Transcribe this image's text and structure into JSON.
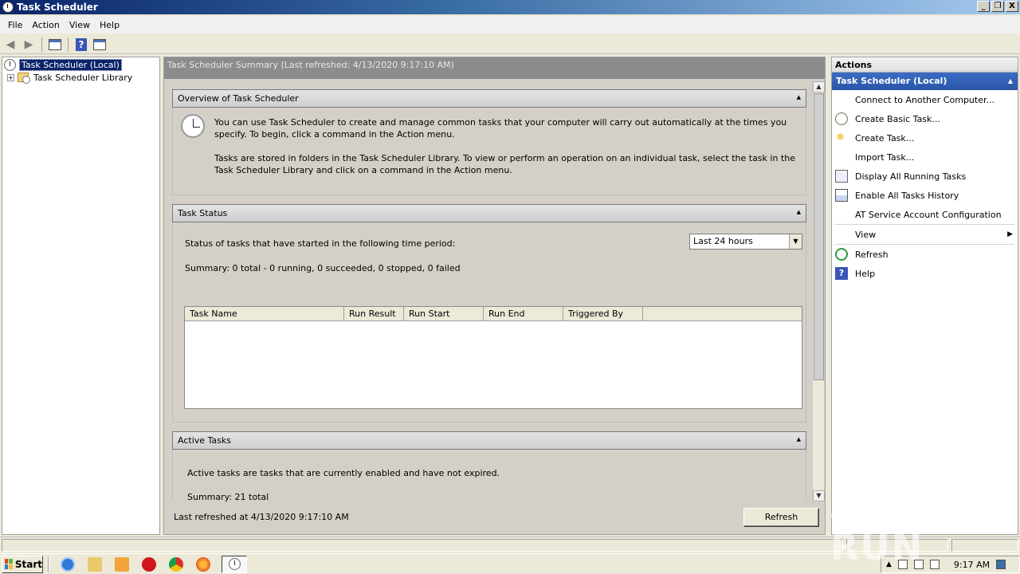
{
  "window": {
    "title": "Task Scheduler",
    "min": "_",
    "max": "❐",
    "close": "X"
  },
  "menu": [
    "File",
    "Action",
    "View",
    "Help"
  ],
  "tree": {
    "root": "Task Scheduler (Local)",
    "child": "Task Scheduler Library"
  },
  "center": {
    "header": "Task Scheduler Summary (Last refreshed: 4/13/2020 9:17:10 AM)",
    "overview": {
      "title": "Overview of Task Scheduler",
      "p1": "You can use Task Scheduler to create and manage common tasks that your computer will carry out automatically at the times you specify. To begin, click a command in the Action menu.",
      "p2": "Tasks are stored in folders in the Task Scheduler Library. To view or perform an operation on an individual task, select the task in the Task Scheduler Library and click on a command in the Action menu."
    },
    "status": {
      "title": "Task Status",
      "period_label": "Status of tasks that have started in the following time period:",
      "period_value": "Last 24 hours",
      "summary": "Summary: 0 total - 0 running, 0 succeeded, 0 stopped, 0 failed",
      "columns": [
        "Task Name",
        "Run Result",
        "Run Start",
        "Run End",
        "Triggered By"
      ]
    },
    "active": {
      "title": "Active Tasks",
      "desc": "Active tasks are tasks that are currently enabled and have not expired.",
      "summary": "Summary: 21 total"
    },
    "last_refreshed": "Last refreshed at 4/13/2020 9:17:10 AM",
    "refresh_button": "Refresh"
  },
  "actions": {
    "title": "Actions",
    "group": "Task Scheduler (Local)",
    "items": [
      "Connect to Another Computer...",
      "Create Basic Task...",
      "Create Task...",
      "Import Task...",
      "Display All Running Tasks",
      "Enable All Tasks History",
      "AT Service Account Configuration",
      "View",
      "Refresh",
      "Help"
    ]
  },
  "taskbar": {
    "start": "Start",
    "time": "9:17 AM"
  },
  "watermark": "ANY RUN"
}
